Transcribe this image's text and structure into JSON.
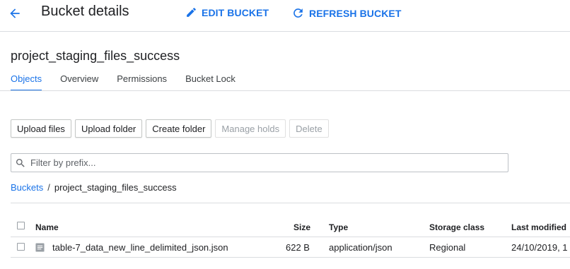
{
  "header": {
    "title": "Bucket details",
    "edit_label": "EDIT BUCKET",
    "refresh_label": "REFRESH BUCKET",
    "icons": {
      "back": "arrow-back-icon",
      "edit": "pencil-icon",
      "refresh": "refresh-icon"
    },
    "accent_color": "#1a73e8"
  },
  "bucket": {
    "name": "project_staging_files_success"
  },
  "tabs": [
    {
      "label": "Objects",
      "active": true
    },
    {
      "label": "Overview",
      "active": false
    },
    {
      "label": "Permissions",
      "active": false
    },
    {
      "label": "Bucket Lock",
      "active": false
    }
  ],
  "toolbar": {
    "upload_files": "Upload files",
    "upload_folder": "Upload folder",
    "create_folder": "Create folder",
    "manage_holds": "Manage holds",
    "delete": "Delete"
  },
  "filter": {
    "placeholder": "Filter by prefix...",
    "value": "",
    "icon": "search-icon"
  },
  "breadcrumb": {
    "root": "Buckets",
    "separator": "/",
    "current": "project_staging_files_success"
  },
  "table": {
    "columns": {
      "name": "Name",
      "size": "Size",
      "type": "Type",
      "storage_class": "Storage class",
      "last_modified": "Last modified"
    },
    "rows": [
      {
        "name": "table-7_data_new_line_delimited_json.json",
        "size": "622 B",
        "type": "application/json",
        "storage_class": "Regional",
        "last_modified": "24/10/2019, 1",
        "icon": "file-icon"
      }
    ]
  }
}
